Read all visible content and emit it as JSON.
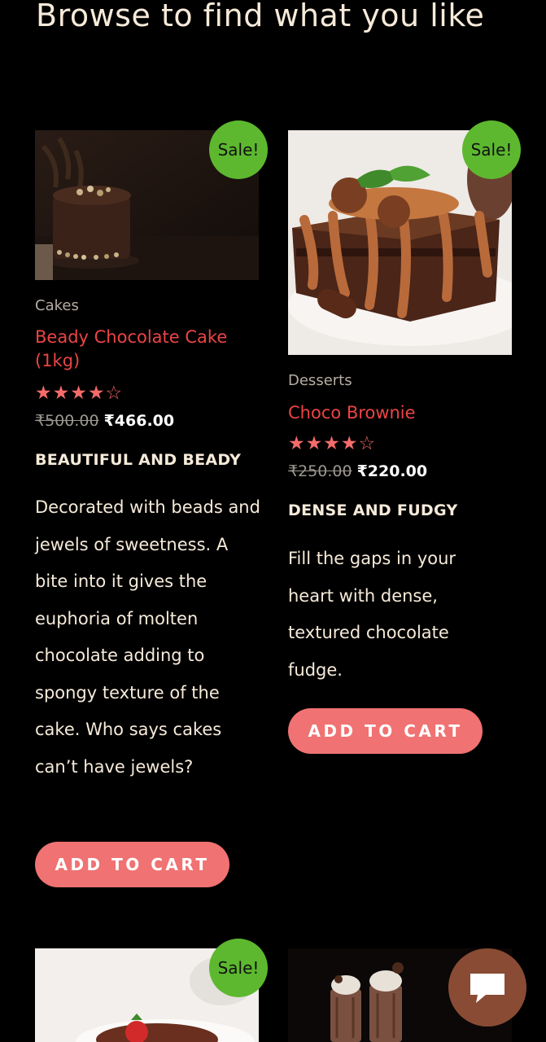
{
  "section": {
    "title": "Browse to find what you like"
  },
  "products": [
    {
      "category": "Cakes",
      "title": "Beady Chocolate Cake (1kg)",
      "rating": 4,
      "rating_max": 5,
      "stars_filled": "★★★★",
      "stars_empty": "☆",
      "old_price": "₹500.00",
      "price": "₹466.00",
      "tagline": "BEAUTIFUL AND BEADY",
      "description": "Decorated with beads and jewels of sweetness. A bite into it gives the euphoria of molten chocolate adding to spongy texture of the cake. Who says cakes can’t have jewels?",
      "badge": "Sale!",
      "cta": "ADD TO CART"
    },
    {
      "category": "Desserts",
      "title": "Choco Brownie",
      "rating": 4,
      "rating_max": 5,
      "stars_filled": "★★★★",
      "stars_empty": "☆",
      "old_price": "₹250.00",
      "price": "₹220.00",
      "tagline": "DENSE AND FUDGY",
      "description": "Fill the gaps in your heart with dense, textured chocolate fudge.",
      "badge": "Sale!",
      "cta": "ADD TO CART"
    }
  ],
  "next_row": {
    "badge": "Sale!"
  },
  "colors": {
    "background": "#000000",
    "sale_badge": "#5db82f",
    "title_red": "#ec4444",
    "button": "#f07272",
    "chat_button": "#8a4b34"
  },
  "icons": {
    "chat": "chat-bubble-icon"
  }
}
